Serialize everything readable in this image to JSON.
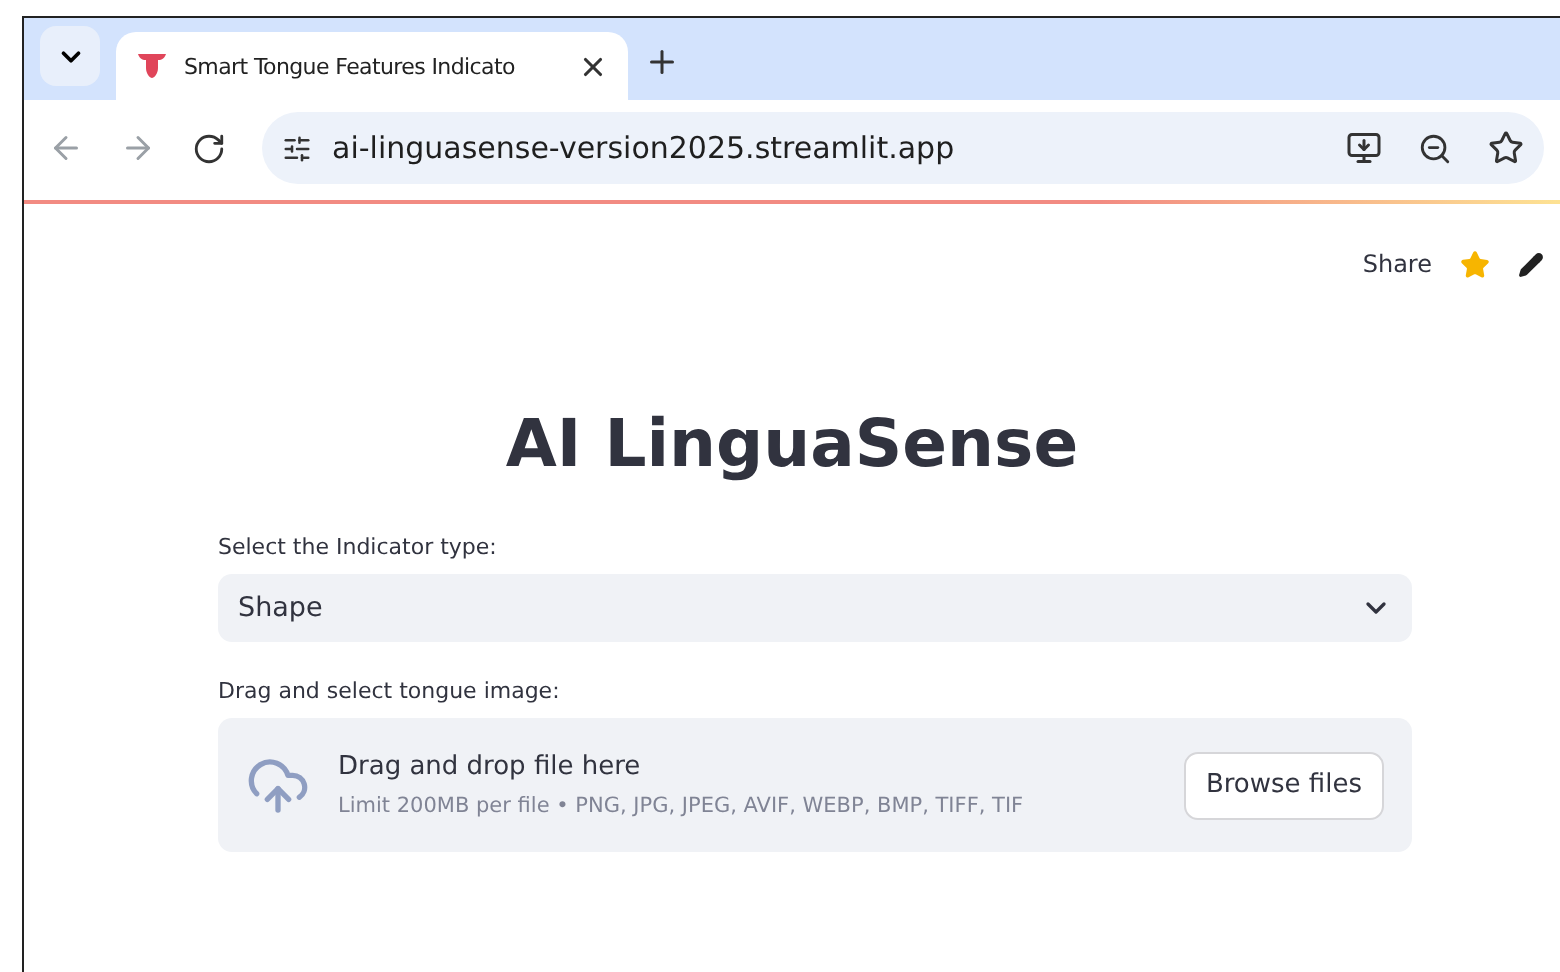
{
  "browser": {
    "tab": {
      "title": "Smart Tongue Features Indicato",
      "selected": true
    },
    "address": "ai-linguasense-version2025.streamlit.app"
  },
  "header": {
    "share": "Share"
  },
  "title": "AI LinguaSense",
  "indicator": {
    "label": "Select the Indicator type:",
    "value": "Shape"
  },
  "uploader": {
    "label": "Drag and select tongue image:",
    "heading": "Drag and drop file here",
    "hint": "Limit 200MB per file • PNG, JPG, JPEG, AVIF, WEBP, BMP, TIFF, TIF",
    "button": "Browse files"
  }
}
